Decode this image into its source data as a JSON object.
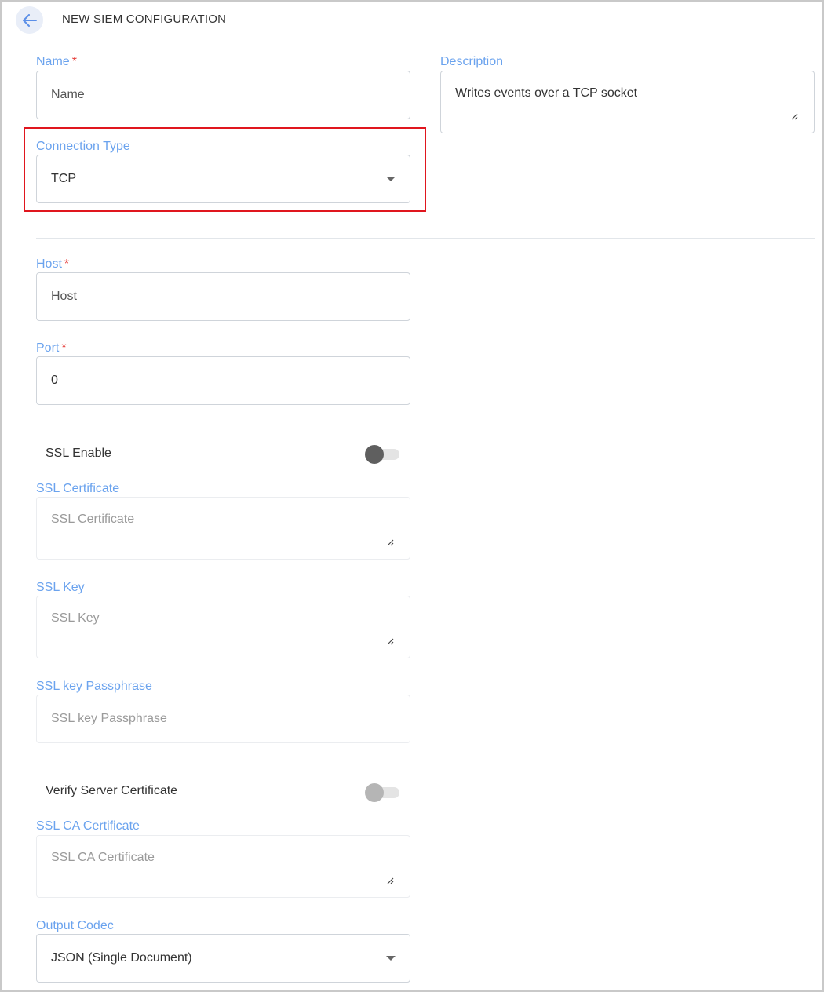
{
  "header": {
    "title": "NEW SIEM CONFIGURATION"
  },
  "form": {
    "name": {
      "label": "Name",
      "required_mark": "*",
      "placeholder": "Name"
    },
    "description": {
      "label": "Description",
      "value": "Writes events over a TCP socket"
    },
    "connection_type": {
      "label": "Connection Type",
      "value": "TCP"
    },
    "host": {
      "label": "Host",
      "required_mark": "*",
      "placeholder": "Host"
    },
    "port": {
      "label": "Port",
      "required_mark": "*",
      "value": "0"
    },
    "ssl_enable": {
      "label": "SSL Enable",
      "enabled": false
    },
    "ssl_certificate": {
      "label": "SSL Certificate",
      "placeholder": "SSL Certificate"
    },
    "ssl_key": {
      "label": "SSL Key",
      "placeholder": "SSL Key"
    },
    "ssl_key_passphrase": {
      "label": "SSL key Passphrase",
      "placeholder": "SSL key Passphrase"
    },
    "verify_server_certificate": {
      "label": "Verify Server Certificate",
      "enabled": false
    },
    "ssl_ca_certificate": {
      "label": "SSL CA Certificate",
      "placeholder": "SSL CA Certificate"
    },
    "output_codec": {
      "label": "Output Codec",
      "value": "JSON (Single Document)"
    }
  },
  "colors": {
    "label": "#6ba3ee",
    "required": "#e53935",
    "highlight": "#e0161e",
    "toggle_thumb_active": "#5f5f5f",
    "toggle_thumb_disabled": "#b5b5b5"
  },
  "icons": {
    "back": "arrow-left-icon",
    "dropdown": "caret-down-icon",
    "resize": "resize-grip-icon"
  }
}
